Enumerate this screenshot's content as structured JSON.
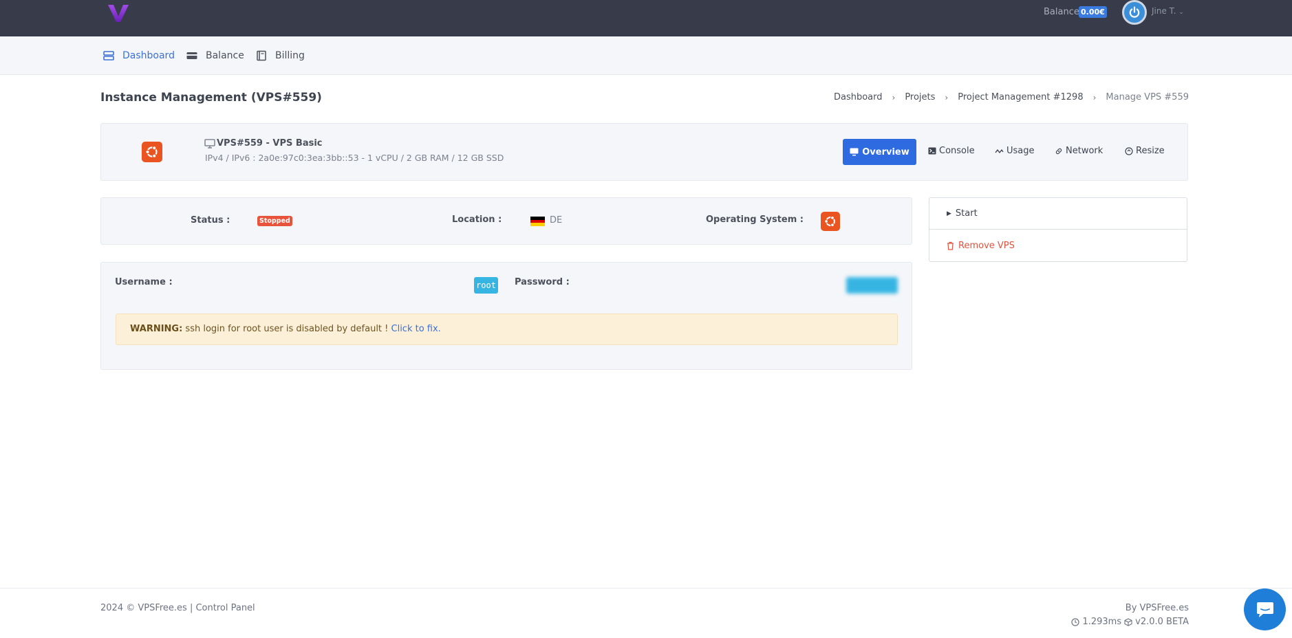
{
  "header": {
    "balance_label": "Balance",
    "balance_value": "0.00€",
    "user_name": "Jine T."
  },
  "nav": {
    "dashboard": "Dashboard",
    "balance": "Balance",
    "billing": "Billing"
  },
  "page": {
    "title": "Instance Management (VPS#559)"
  },
  "breadcrumb": [
    "Dashboard",
    "Projets",
    "Project Management #1298",
    "Manage VPS #559"
  ],
  "vps": {
    "name": "VPS#559 - VPS Basic",
    "specs": "IPv4 / IPv6 : 2a0e:97c0:3ea:3bb::53 - 1 vCPU / 2 GB RAM / 12 GB SSD"
  },
  "tabs": {
    "overview": "Overview",
    "console": "Console",
    "usage": "Usage",
    "network": "Network",
    "resize": "Resize"
  },
  "info": {
    "status_label": "Status :",
    "status_value": "Stopped",
    "location_label": "Location :",
    "location_value": "DE",
    "os_label": "Operating System :"
  },
  "credentials": {
    "username_label": "Username :",
    "username_value": "root",
    "password_label": "Password :",
    "password_value": "hidden"
  },
  "warning": {
    "prefix": "WARNING:",
    "message": " ssh login for root user is disabled by default ! ",
    "link": "Click to fix."
  },
  "actions": {
    "start": "Start",
    "remove": "Remove VPS"
  },
  "footer": {
    "copyright": "2024 © VPSFree.es | Control Panel",
    "by": "By VPSFree.es",
    "timing": "1.293ms",
    "version": "v2.0.0 BETA"
  },
  "colors": {
    "primary": "#2e6ae0",
    "danger": "#e8533b",
    "ubuntu": "#e95420",
    "info": "#36b5e3"
  }
}
